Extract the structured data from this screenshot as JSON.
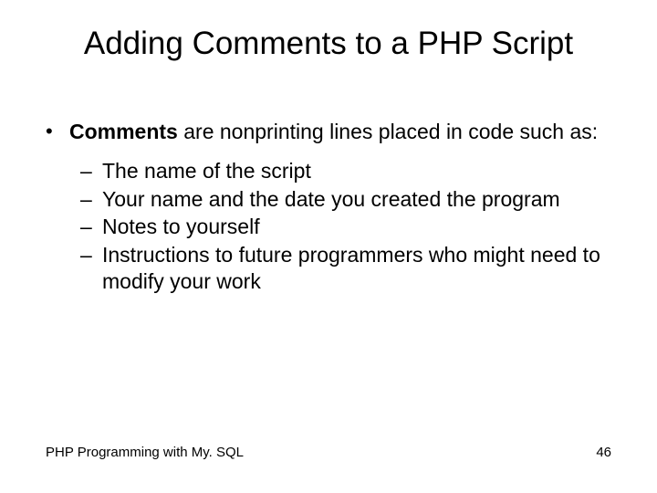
{
  "title": "Adding Comments to a PHP Script",
  "bullet": {
    "marker": "•",
    "bold_lead": "Comments",
    "rest": " are nonprinting lines placed in code such as:"
  },
  "subitems": [
    {
      "dash": "–",
      "text": "The name of the script"
    },
    {
      "dash": "–",
      "text": "Your name and the date you created the program"
    },
    {
      "dash": "–",
      "text": "Notes to yourself"
    },
    {
      "dash": "–",
      "text": "Instructions to future programmers who might need to modify your work"
    }
  ],
  "footer": {
    "left": "PHP Programming with My. SQL",
    "right": "46"
  }
}
